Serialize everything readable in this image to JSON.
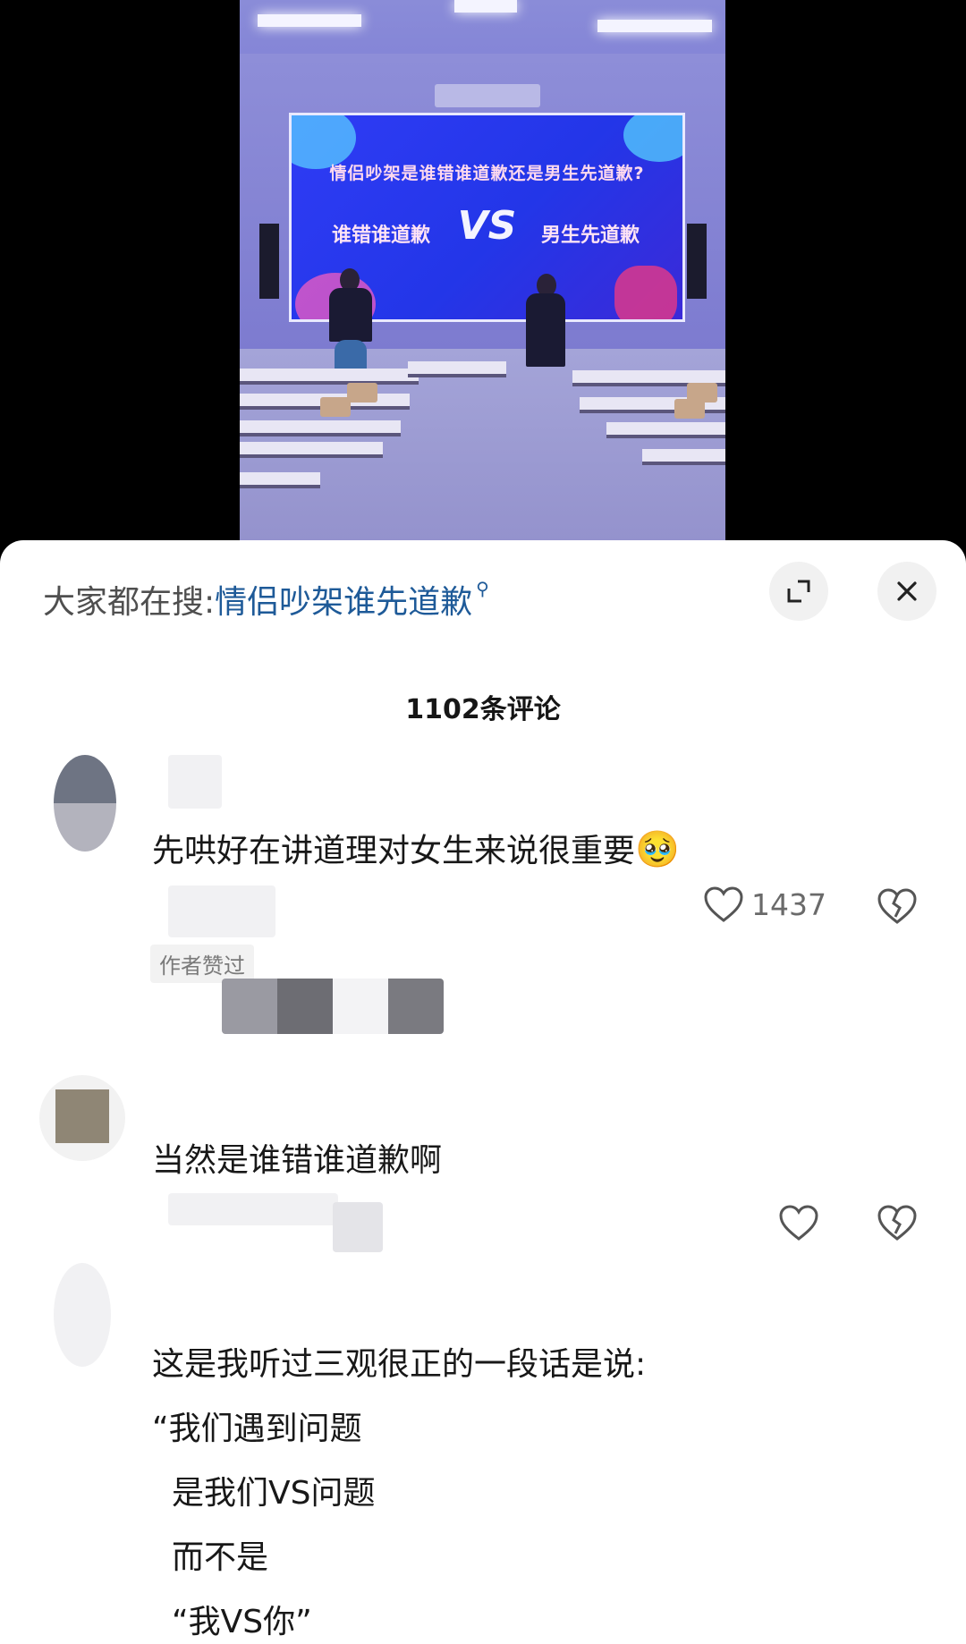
{
  "video": {
    "screen_title": "情侣吵架是谁错谁道歉还是男生先道歉?",
    "left_option": "谁错谁道歉",
    "vs": "VS",
    "right_option": "男生先道歉"
  },
  "search": {
    "prefix": "大家都在搜:",
    "query": "情侣吵架谁先道歉",
    "icon": "search-icon"
  },
  "header": {
    "comment_count": "1102条评论",
    "expand_icon": "expand-icon",
    "close_icon": "close-icon"
  },
  "comments": [
    {
      "text": "先哄好在讲道理对女生来说很重要",
      "emoji": "🥹",
      "likes": "1437",
      "badge": "作者赞过"
    },
    {
      "text": "当然是谁错谁道歉啊",
      "likes": ""
    },
    {
      "lines": [
        "这是我听过三观很正的一段话是说:",
        "“我们遇到问题",
        "是我们VS问题",
        "而不是",
        "“我VS你”"
      ]
    }
  ],
  "colors": {
    "accent_link": "#1e5a98",
    "screen_blue": "#2336e8",
    "text_primary": "#181818",
    "text_secondary": "#6a6a6a"
  }
}
